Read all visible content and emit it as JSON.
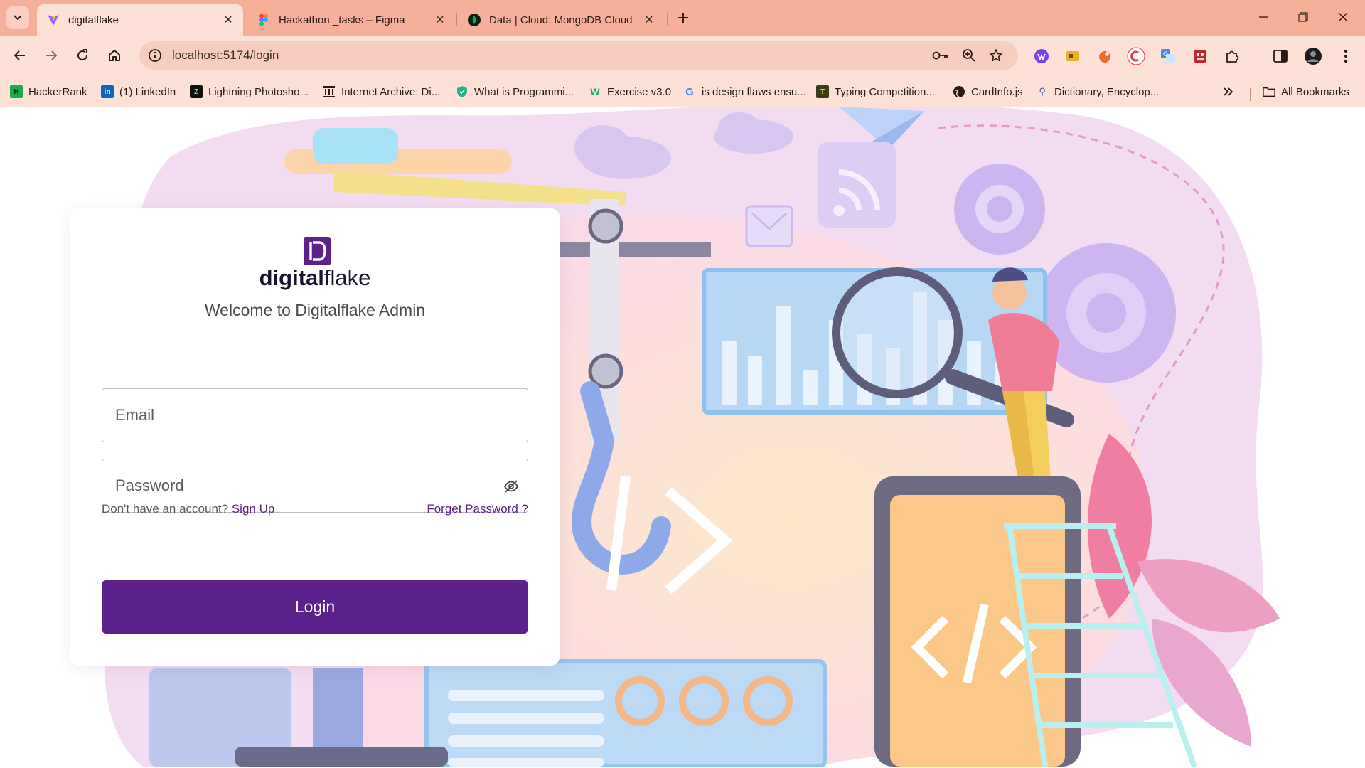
{
  "browser": {
    "tabs": [
      {
        "title": "digitalflake",
        "active": true,
        "favicon": "vite-icon"
      },
      {
        "title": "Hackathon _tasks – Figma",
        "active": false,
        "favicon": "figma-icon"
      },
      {
        "title": "Data | Cloud: MongoDB Cloud",
        "active": false,
        "favicon": "mongodb-leaf-icon"
      }
    ],
    "address_bar": {
      "url": "localhost:5174/login"
    },
    "bookmarks": [
      {
        "label": "HackerRank",
        "icon": "hackerrank-icon"
      },
      {
        "label": "(1) LinkedIn",
        "icon": "linkedin-icon"
      },
      {
        "label": "Lightning Photosho...",
        "icon": "lightning-icon"
      },
      {
        "label": "Internet Archive: Di...",
        "icon": "archive-icon"
      },
      {
        "label": "What is Programmi...",
        "icon": "shield-icon"
      },
      {
        "label": "Exercise v3.0",
        "icon": "w3-icon"
      },
      {
        "label": "is design flaws ensu...",
        "icon": "google-icon"
      },
      {
        "label": "Typing Competition...",
        "icon": "typing-icon"
      },
      {
        "label": "CardInfo.js",
        "icon": "globe-icon"
      },
      {
        "label": "Dictionary, Encyclop...",
        "icon": "dictionary-icon"
      }
    ],
    "all_bookmarks_label": "All Bookmarks"
  },
  "colors": {
    "brand": "#5c218a",
    "chrome_tabstrip": "#f6b09a",
    "chrome_toolbar": "#fde0d6"
  },
  "login": {
    "logo_mark": "D",
    "logo_bold": "digital",
    "logo_regular": "flake",
    "welcome": "Welcome to Digitalflake Admin",
    "email_placeholder": "Email",
    "password_placeholder": "Password",
    "no_account_text": "Don't have an account?",
    "signup_label": "Sign Up",
    "forgot_label": "Forget Password ?",
    "login_label": "Login"
  }
}
